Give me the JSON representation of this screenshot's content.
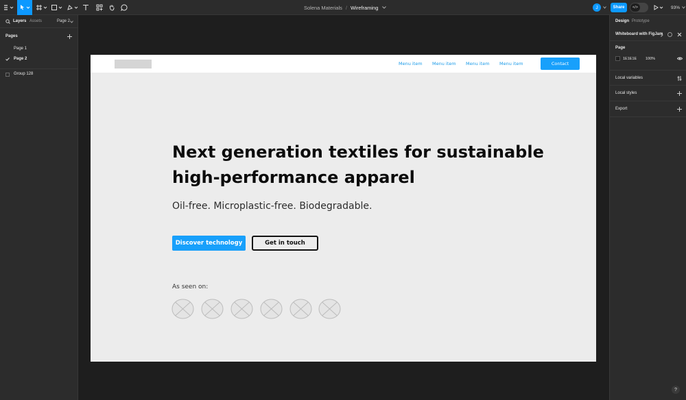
{
  "toolbar": {
    "file_name": "Solena Materials",
    "separator": "/",
    "page_name": "Wireframing",
    "avatar_initial": "J",
    "share_label": "Share",
    "dev_mode_label": "</>",
    "zoom": "93%"
  },
  "left_panel": {
    "tabs": [
      "Layers",
      "Assets"
    ],
    "page_selector": "Page 2",
    "pages_heading": "Pages",
    "pages": [
      {
        "label": "Page 1",
        "selected": false
      },
      {
        "label": "Page 2",
        "selected": true
      }
    ],
    "layers": [
      {
        "label": "Group 128"
      }
    ]
  },
  "right_panel": {
    "tabs": [
      "Design",
      "Prototype"
    ],
    "plugin_title": "Whiteboard with FigJam",
    "page_section": "Page",
    "page_color_hex": "1E1E1E",
    "page_opacity": "100%",
    "local_variables": "Local variables",
    "local_styles": "Local styles",
    "export": "Export",
    "help": "?"
  },
  "frame": {
    "menu_items": [
      "Menu item",
      "Menu item",
      "Menu item",
      "Menu item"
    ],
    "contact_label": "Contact",
    "hero_title": "Next generation textiles for sustainable high-performance apparel",
    "hero_subtitle": "Oil-free. Microplastic-free. Biodegradable.",
    "primary_cta": "Discover technology",
    "secondary_cta": "Get in touch",
    "seen_on_label": "As seen on:",
    "colors": {
      "accent": "#18a0fb",
      "frame_bg": "#ececec",
      "canvas_bg": "#1e1e1e"
    }
  }
}
